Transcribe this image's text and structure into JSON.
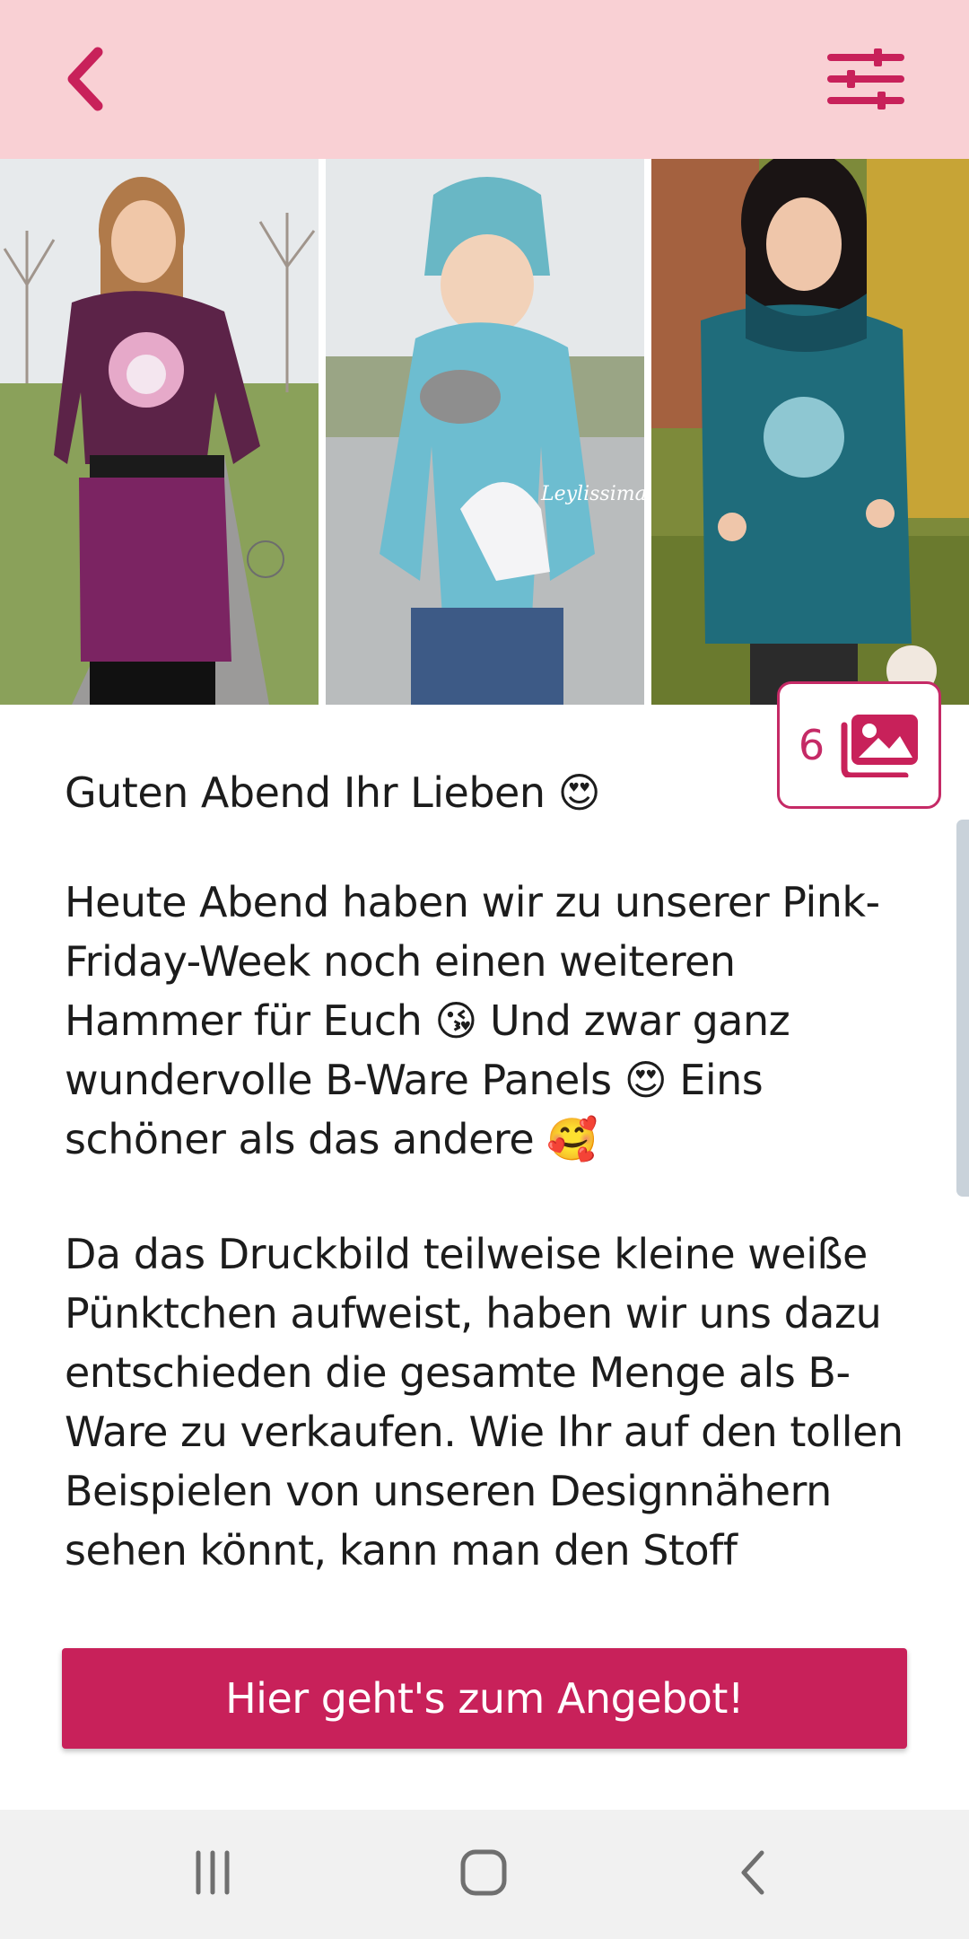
{
  "header": {
    "back_icon": "chevron-left-icon",
    "filter_icon": "sliders-icon",
    "accent_color": "#c8215a",
    "background_color": "#f9d0d4"
  },
  "gallery": {
    "photos": [
      "photo-woman-deer-sweater",
      "photo-child-horse-hoodie",
      "photo-woman-teal-dress"
    ],
    "photo_count": "6",
    "photo_count_icon": "images-icon"
  },
  "article": {
    "paragraphs": [
      "Guten Abend Ihr Lieben 😍",
      "Heute Abend haben wir zu unserer Pink-Friday-Week noch einen weiteren Hammer für Euch 😘 Und zwar ganz wundervolle B-Ware Panels 😍 Eins schöner als das andere 🥰",
      "Da das Druckbild teilweise kleine weiße Pünktchen aufweist, haben wir uns dazu entschieden die gesamte Menge als B-Ware zu verkaufen. Wie Ihr auf den tollen Beispielen von unseren Designnähern sehen könnt, kann man den Stoff trotzdem"
    ]
  },
  "cta": {
    "label": "Hier geht's zum Angebot!"
  },
  "system_nav": {
    "recent_icon": "recent-apps-icon",
    "home_icon": "home-icon",
    "back_icon": "back-icon"
  }
}
